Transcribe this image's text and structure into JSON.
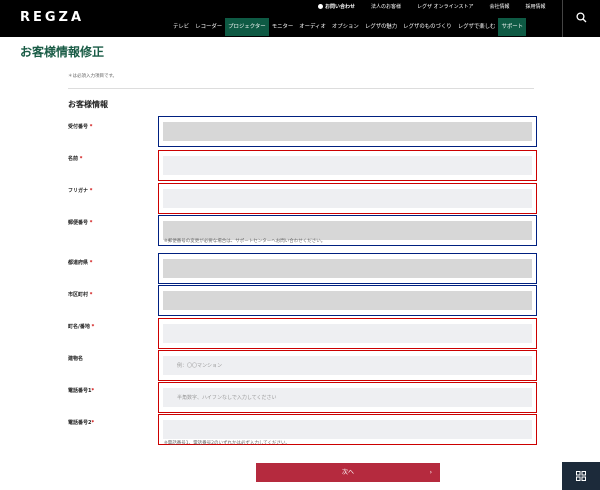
{
  "header": {
    "logo": "REGZA",
    "utility": [
      "お問い合わせ",
      "法人のお客様",
      "レグザ オンラインストア",
      "会社情報",
      "採用情報"
    ],
    "nav": [
      "テレビ",
      "レコーダー",
      "プロジェクター",
      "モニター",
      "オーディオ",
      "オプション",
      "レグザの魅力",
      "レグザのものづくり",
      "レグザで楽しむ",
      "サポート"
    ],
    "active_nav": [
      "プロジェクター",
      "サポート"
    ]
  },
  "page": {
    "title": "お客様情報修正",
    "required_note": "＊は必須入力項目です。",
    "section_title": "お客様情報"
  },
  "fields": [
    {
      "label": "受付番号",
      "required": true,
      "placeholder": "",
      "hint": ""
    },
    {
      "label": "名前",
      "required": true,
      "placeholder": "",
      "hint": ""
    },
    {
      "label": "フリガナ",
      "required": true,
      "placeholder": "",
      "hint": ""
    },
    {
      "label": "郵便番号",
      "required": true,
      "placeholder": "",
      "hint": "※郵便番号の変更が必要な場合は、サポートセンターへお問い合わせください。"
    },
    {
      "label": "都道府県",
      "required": true,
      "placeholder": "",
      "hint": ""
    },
    {
      "label": "市区町村",
      "required": true,
      "placeholder": "",
      "hint": ""
    },
    {
      "label": "町名/番地",
      "required": true,
      "placeholder": "",
      "hint": ""
    },
    {
      "label": "建物名",
      "required": false,
      "placeholder": "例：〇〇マンション",
      "hint": ""
    },
    {
      "label": "電話番号1",
      "required": true,
      "placeholder": "半角数字、ハイフンなしで入力してください",
      "hint": ""
    },
    {
      "label": "電話番号2",
      "required": true,
      "placeholder": "",
      "hint": "※電話番号1、電話番号2のいずれかは必ず入力してください。"
    }
  ],
  "next_button": "次へ",
  "colors": {
    "brand_green": "#1a5c46",
    "button_red": "#b52a3e",
    "annot_red": "#cc0000",
    "annot_blue": "#002080"
  }
}
